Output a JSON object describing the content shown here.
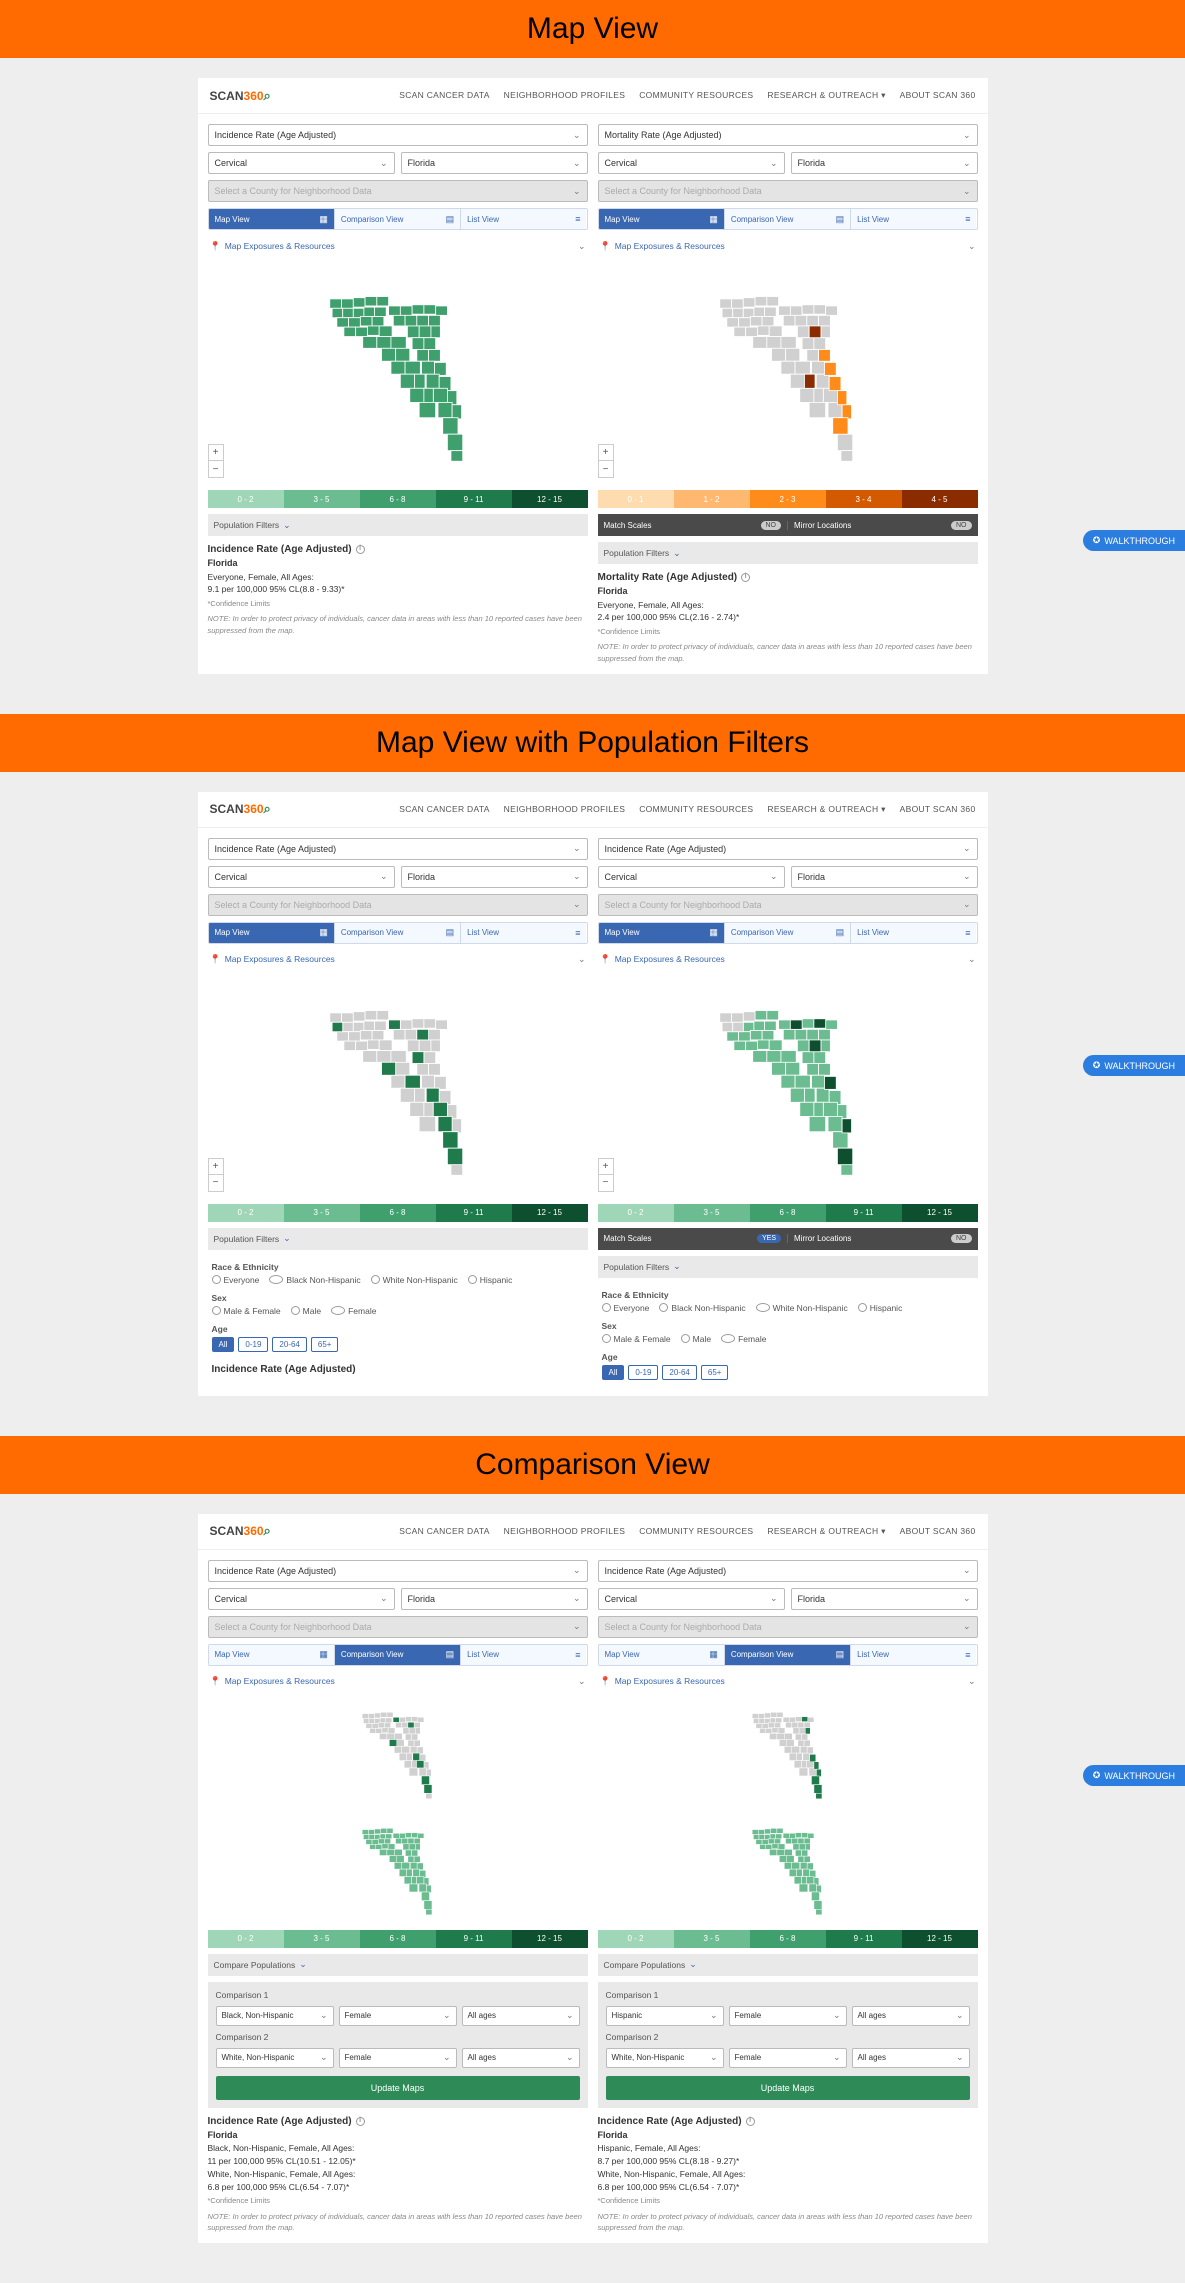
{
  "banners": {
    "map_view": "Map View",
    "map_view_filters": "Map View with Population Filters",
    "comparison_view": "Comparison View"
  },
  "logo": {
    "part1": "SCAN",
    "part2": "360"
  },
  "nav": [
    "SCAN CANCER DATA",
    "NEIGHBORHOOD PROFILES",
    "COMMUNITY RESOURCES",
    "RESEARCH & OUTREACH ▾",
    "ABOUT SCAN 360"
  ],
  "walkthrough": "WALKTHROUGH",
  "common": {
    "county_placeholder": "Select a County for Neighborhood Data",
    "tabs": {
      "map": "Map View",
      "compare": "Comparison View",
      "list": "List View"
    },
    "exposures": "Map Exposures & Resources",
    "zoom_plus": "+",
    "zoom_minus": "−",
    "popfilters": "Population Filters",
    "match_scales": "Match Scales",
    "mirror_locations": "Mirror Locations",
    "toggle_no": "NO",
    "toggle_yes": "YES",
    "info": "i",
    "chev": "⌄",
    "ham": "≡",
    "note": "NOTE: In order to protect privacy of individuals, cancer data in areas with less than 10 reported cases have been suppressed from the map.",
    "conf": "*Confidence Limits"
  },
  "legend_green": [
    {
      "label": "0 - 2",
      "color": "#9fd6b7"
    },
    {
      "label": "3 - 5",
      "color": "#6bbd91"
    },
    {
      "label": "6 - 8",
      "color": "#3fa06e"
    },
    {
      "label": "9 - 11",
      "color": "#1f7a4c"
    },
    {
      "label": "12 - 15",
      "color": "#0d4f2e"
    }
  ],
  "legend_orange": [
    {
      "label": "0 - 1",
      "color": "#ffdcb0"
    },
    {
      "label": "1 - 2",
      "color": "#ffb870"
    },
    {
      "label": "2 - 3",
      "color": "#ff8c1a"
    },
    {
      "label": "3 - 4",
      "color": "#d35a00"
    },
    {
      "label": "4 - 5",
      "color": "#8b2c00"
    }
  ],
  "section1": {
    "left": {
      "measure": "Incidence Rate (Age Adjusted)",
      "site": "Cervical",
      "region": "Florida",
      "report": {
        "title": "Incidence Rate (Age Adjusted)",
        "loc": "Florida",
        "sub1": "Everyone, Female, All Ages:",
        "sub2": "9.1 per 100,000    95% CL(8.8 - 9.33)*"
      }
    },
    "right": {
      "measure": "Mortality Rate (Age Adjusted)",
      "site": "Cervical",
      "region": "Florida",
      "report": {
        "title": "Mortality Rate (Age Adjusted)",
        "loc": "Florida",
        "sub1": "Everyone, Female, All Ages:",
        "sub2": "2.4 per 100,000    95% CL(2.16 - 2.74)*"
      }
    }
  },
  "section2": {
    "filters_label_race": "Race & Ethnicity",
    "filters_label_sex": "Sex",
    "filters_label_age": "Age",
    "race_opts": [
      "Everyone",
      "Black Non-Hispanic",
      "White Non-Hispanic",
      "Hispanic"
    ],
    "sex_opts": [
      "Male & Female",
      "Male",
      "Female"
    ],
    "age_opts": [
      "All",
      "0-19",
      "20-64",
      "65+"
    ],
    "left": {
      "measure": "Incidence Rate (Age Adjusted)",
      "site": "Cervical",
      "region": "Florida",
      "race_sel": "Black Non-Hispanic",
      "sex_sel": "Female",
      "age_sel": "All"
    },
    "right": {
      "measure": "Incidence Rate (Age Adjusted)",
      "site": "Cervical",
      "region": "Florida",
      "race_sel": "White Non-Hispanic",
      "sex_sel": "Female",
      "age_sel": "All"
    },
    "truncated_title": "Incidence Rate (Age Adjusted)"
  },
  "section3": {
    "compare_pop": "Compare Populations",
    "comp1_label": "Comparison 1",
    "comp2_label": "Comparison 2",
    "update": "Update Maps",
    "left": {
      "measure": "Incidence Rate (Age Adjusted)",
      "site": "Cervical",
      "region": "Florida",
      "comp1": {
        "race": "Black, Non-Hispanic",
        "sex": "Female",
        "age": "All ages"
      },
      "comp2": {
        "race": "White, Non-Hispanic",
        "sex": "Female",
        "age": "All ages"
      },
      "report": {
        "title": "Incidence Rate (Age Adjusted)",
        "loc": "Florida",
        "l1": "Black, Non-Hispanic, Female, All Ages:",
        "l2": "11 per 100,000    95% CL(10.51 - 12.05)*",
        "l3": "White, Non-Hispanic, Female, All Ages:",
        "l4": "6.8 per 100,000    95% CL(6.54 - 7.07)*"
      }
    },
    "right": {
      "measure": "Incidence Rate (Age Adjusted)",
      "site": "Cervical",
      "region": "Florida",
      "comp1": {
        "race": "Hispanic",
        "sex": "Female",
        "age": "All ages"
      },
      "comp2": {
        "race": "White, Non-Hispanic",
        "sex": "Female",
        "age": "All ages"
      },
      "report": {
        "title": "Incidence Rate (Age Adjusted)",
        "loc": "Florida",
        "l1": "Hispanic, Female, All Ages:",
        "l2": "8.7 per 100,000    95% CL(8.18 - 9.27)*",
        "l3": "White, Non-Hispanic, Female, All Ages:",
        "l4": "6.8 per 100,000    95% CL(6.54 - 7.07)*"
      }
    }
  }
}
